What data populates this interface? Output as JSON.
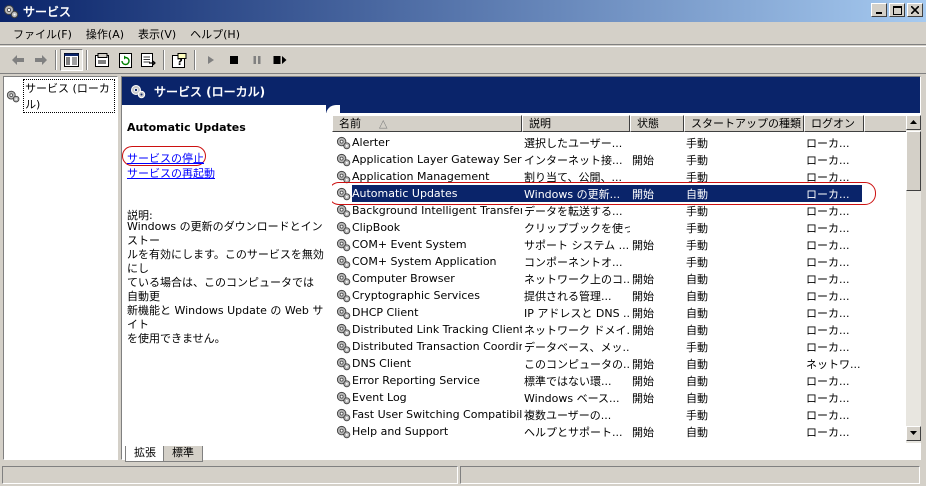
{
  "window": {
    "title": "サービス",
    "buttons": {
      "minimize": "_",
      "maximize": "□",
      "close": "×"
    }
  },
  "menu": [
    {
      "label": "ファイル(F)",
      "name": "menu-file"
    },
    {
      "label": "操作(A)",
      "name": "menu-action"
    },
    {
      "label": "表示(V)",
      "name": "menu-view"
    },
    {
      "label": "ヘルプ(H)",
      "name": "menu-help"
    }
  ],
  "tree": {
    "root_label": "サービス (ローカル)"
  },
  "pane": {
    "banner_title": "サービス (ローカル)",
    "selected_service": "Automatic Updates",
    "actions": {
      "stop": "サービスの停止",
      "restart": "サービスの再起動"
    },
    "description_label": "説明:",
    "description_lines": [
      "Windows の更新のダウンロードとインストー",
      "ルを有効にします。このサービスを無効にし",
      "ている場合は、このコンピュータでは 自動更",
      "新機能と Windows Update の Web サイト",
      "を使用できません。"
    ]
  },
  "columns": [
    {
      "label": "名前",
      "width": 190
    },
    {
      "label": "説明",
      "width": 108
    },
    {
      "label": "状態",
      "width": 54
    },
    {
      "label": "スタートアップの種類",
      "width": 120
    },
    {
      "label": "ログオン",
      "width": 60
    }
  ],
  "sort_indicator": "△",
  "services": [
    {
      "name": "Alerter",
      "desc": "選択したユーザー...",
      "status": "",
      "startup": "手動",
      "logon": "ローカ..."
    },
    {
      "name": "Application Layer Gateway Serv...",
      "desc": "インターネット接...",
      "status": "開始",
      "startup": "手動",
      "logon": "ローカ..."
    },
    {
      "name": "Application Management",
      "desc": "割り当て、公開、...",
      "status": "",
      "startup": "手動",
      "logon": "ローカ..."
    },
    {
      "name": "Automatic Updates",
      "desc": "Windows の更新...",
      "status": "開始",
      "startup": "自動",
      "logon": "ローカ...",
      "selected": true
    },
    {
      "name": "Background Intelligent Transfer...",
      "desc": "データを転送する...",
      "status": "",
      "startup": "手動",
      "logon": "ローカ..."
    },
    {
      "name": "ClipBook",
      "desc": "クリップブックを使っ...",
      "status": "",
      "startup": "手動",
      "logon": "ローカ..."
    },
    {
      "name": "COM+ Event System",
      "desc": "サポート システム ...",
      "status": "開始",
      "startup": "手動",
      "logon": "ローカ..."
    },
    {
      "name": "COM+ System Application",
      "desc": "コンポーネントオ...",
      "status": "",
      "startup": "手動",
      "logon": "ローカ..."
    },
    {
      "name": "Computer Browser",
      "desc": "ネットワーク上のコ...",
      "status": "開始",
      "startup": "自動",
      "logon": "ローカ..."
    },
    {
      "name": "Cryptographic Services",
      "desc": "提供される管理...",
      "status": "開始",
      "startup": "自動",
      "logon": "ローカ..."
    },
    {
      "name": "DHCP Client",
      "desc": "IP アドレスと DNS ...",
      "status": "開始",
      "startup": "自動",
      "logon": "ローカ..."
    },
    {
      "name": "Distributed Link Tracking Client",
      "desc": "ネットワーク ドメイ...",
      "status": "開始",
      "startup": "自動",
      "logon": "ローカ..."
    },
    {
      "name": "Distributed Transaction Coordin...",
      "desc": "データベース、メッ...",
      "status": "",
      "startup": "手動",
      "logon": "ローカ..."
    },
    {
      "name": "DNS Client",
      "desc": "このコンピュータの...",
      "status": "開始",
      "startup": "自動",
      "logon": "ネットワ..."
    },
    {
      "name": "Error Reporting Service",
      "desc": "標準ではない環...",
      "status": "開始",
      "startup": "自動",
      "logon": "ローカ..."
    },
    {
      "name": "Event Log",
      "desc": "Windows ベース...",
      "status": "開始",
      "startup": "自動",
      "logon": "ローカ..."
    },
    {
      "name": "Fast User Switching Compatibility",
      "desc": "複数ユーザーの...",
      "status": "",
      "startup": "手動",
      "logon": "ローカ..."
    },
    {
      "name": "Help and Support",
      "desc": "ヘルプとサポート...",
      "status": "開始",
      "startup": "自動",
      "logon": "ローカ..."
    }
  ],
  "tabs": [
    {
      "label": "拡張",
      "active": true
    },
    {
      "label": "標準",
      "active": false
    }
  ]
}
